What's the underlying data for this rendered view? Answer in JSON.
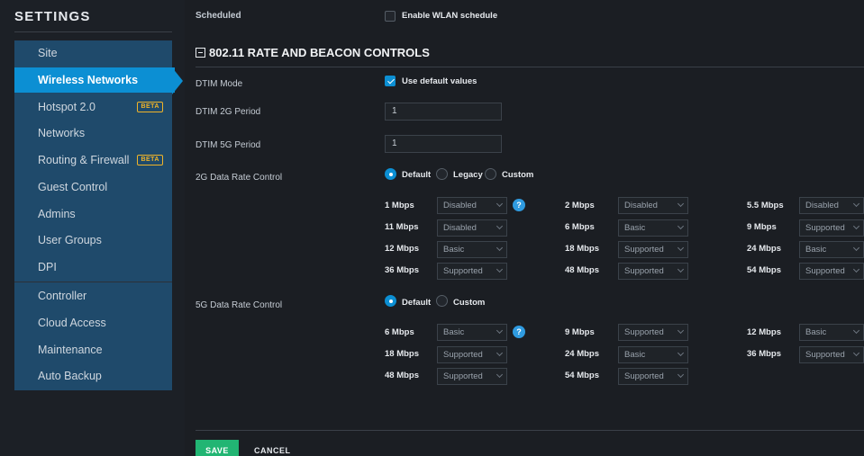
{
  "sidebar": {
    "title": "SETTINGS",
    "items": [
      {
        "label": "Site"
      },
      {
        "label": "Wireless Networks"
      },
      {
        "label": "Hotspot 2.0",
        "badge": "BETA"
      },
      {
        "label": "Networks"
      },
      {
        "label": "Routing & Firewall",
        "badge": "BETA"
      },
      {
        "label": "Guest Control"
      },
      {
        "label": "Admins"
      },
      {
        "label": "User Groups"
      },
      {
        "label": "DPI"
      },
      {
        "label": "Controller"
      },
      {
        "label": "Cloud Access"
      },
      {
        "label": "Maintenance"
      },
      {
        "label": "Auto Backup"
      }
    ]
  },
  "main": {
    "scheduled_label": "Scheduled",
    "scheduled_checkbox_label": "Enable WLAN schedule",
    "section_title": "802.11 RATE AND BEACON CONTROLS",
    "dtim_mode_label": "DTIM Mode",
    "dtim_default_label": "Use default values",
    "dtim_2g_label": "DTIM 2G Period",
    "dtim_2g_value": "1",
    "dtim_5g_label": "DTIM 5G Period",
    "dtim_5g_value": "1",
    "rate_2g_label": "2G Data Rate Control",
    "rate_2g_options": [
      "Default",
      "Legacy",
      "Custom"
    ],
    "rates_2g": [
      {
        "rate": "1 Mbps",
        "value": "Disabled"
      },
      {
        "rate": "2 Mbps",
        "value": "Disabled"
      },
      {
        "rate": "5.5 Mbps",
        "value": "Disabled"
      },
      {
        "rate": "11 Mbps",
        "value": "Disabled"
      },
      {
        "rate": "6 Mbps",
        "value": "Basic"
      },
      {
        "rate": "9 Mbps",
        "value": "Supported"
      },
      {
        "rate": "12 Mbps",
        "value": "Basic"
      },
      {
        "rate": "18 Mbps",
        "value": "Supported"
      },
      {
        "rate": "24 Mbps",
        "value": "Basic"
      },
      {
        "rate": "36 Mbps",
        "value": "Supported"
      },
      {
        "rate": "48 Mbps",
        "value": "Supported"
      },
      {
        "rate": "54 Mbps",
        "value": "Supported"
      }
    ],
    "rate_5g_label": "5G Data Rate Control",
    "rate_5g_options": [
      "Default",
      "Custom"
    ],
    "rates_5g": [
      {
        "rate": "6 Mbps",
        "value": "Basic"
      },
      {
        "rate": "9 Mbps",
        "value": "Supported"
      },
      {
        "rate": "12 Mbps",
        "value": "Basic"
      },
      {
        "rate": "18 Mbps",
        "value": "Supported"
      },
      {
        "rate": "24 Mbps",
        "value": "Basic"
      },
      {
        "rate": "36 Mbps",
        "value": "Supported"
      },
      {
        "rate": "48 Mbps",
        "value": "Supported"
      },
      {
        "rate": "54 Mbps",
        "value": "Supported"
      }
    ],
    "help_glyph": "?",
    "save_label": "SAVE",
    "cancel_label": "CANCEL"
  },
  "colors": {
    "accent": "#0c8fd3",
    "save_green": "#22b573",
    "beta_badge": "#f0b429"
  }
}
